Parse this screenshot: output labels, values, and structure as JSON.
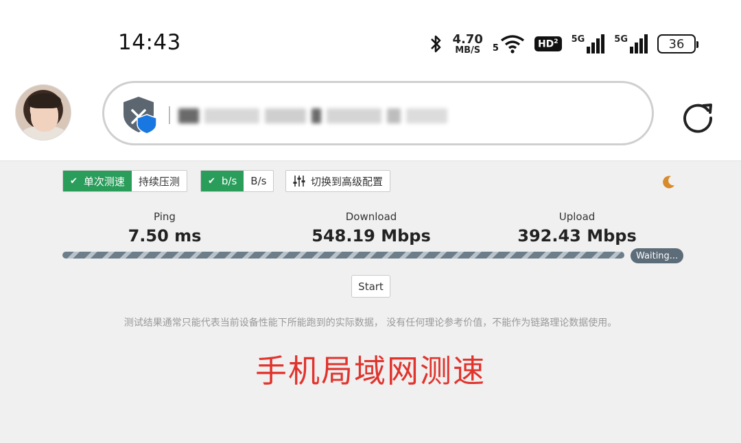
{
  "status_bar": {
    "time": "14:43",
    "net_speed_value": "4.70",
    "net_speed_unit": "MB/S",
    "wifi_band": "5",
    "hd_label": "HD",
    "hd_sub": "2",
    "sim1_label": "5G",
    "sim2_label": "5G",
    "battery": "36"
  },
  "browser": {
    "icons": [
      "avatar",
      "shield-icon",
      "reload-icon"
    ]
  },
  "toolbar": {
    "mode_single": "单次测速",
    "mode_continuous": "持续压测",
    "unit_bits": "b/s",
    "unit_bytes": "B/s",
    "advanced_label": "切换到高级配置",
    "check_mark": "✔"
  },
  "metrics": {
    "ping": {
      "name": "Ping",
      "value": "7.50 ms"
    },
    "download": {
      "name": "Download",
      "value": "548.19 Mbps"
    },
    "upload": {
      "name": "Upload",
      "value": "392.43 Mbps"
    }
  },
  "progress": {
    "status": "Waiting..."
  },
  "start_label": "Start",
  "disclaimer": "测试结果通常只能代表当前设备性能下所能跑到的实际数据， 没有任何理论参考价值，不能作为链路理论数据使用。",
  "overlay_title": "手机局域网测速",
  "colors": {
    "accent_green": "#2a9d5b",
    "overlay_red": "#e0342d",
    "badge": "#5c6c78"
  }
}
